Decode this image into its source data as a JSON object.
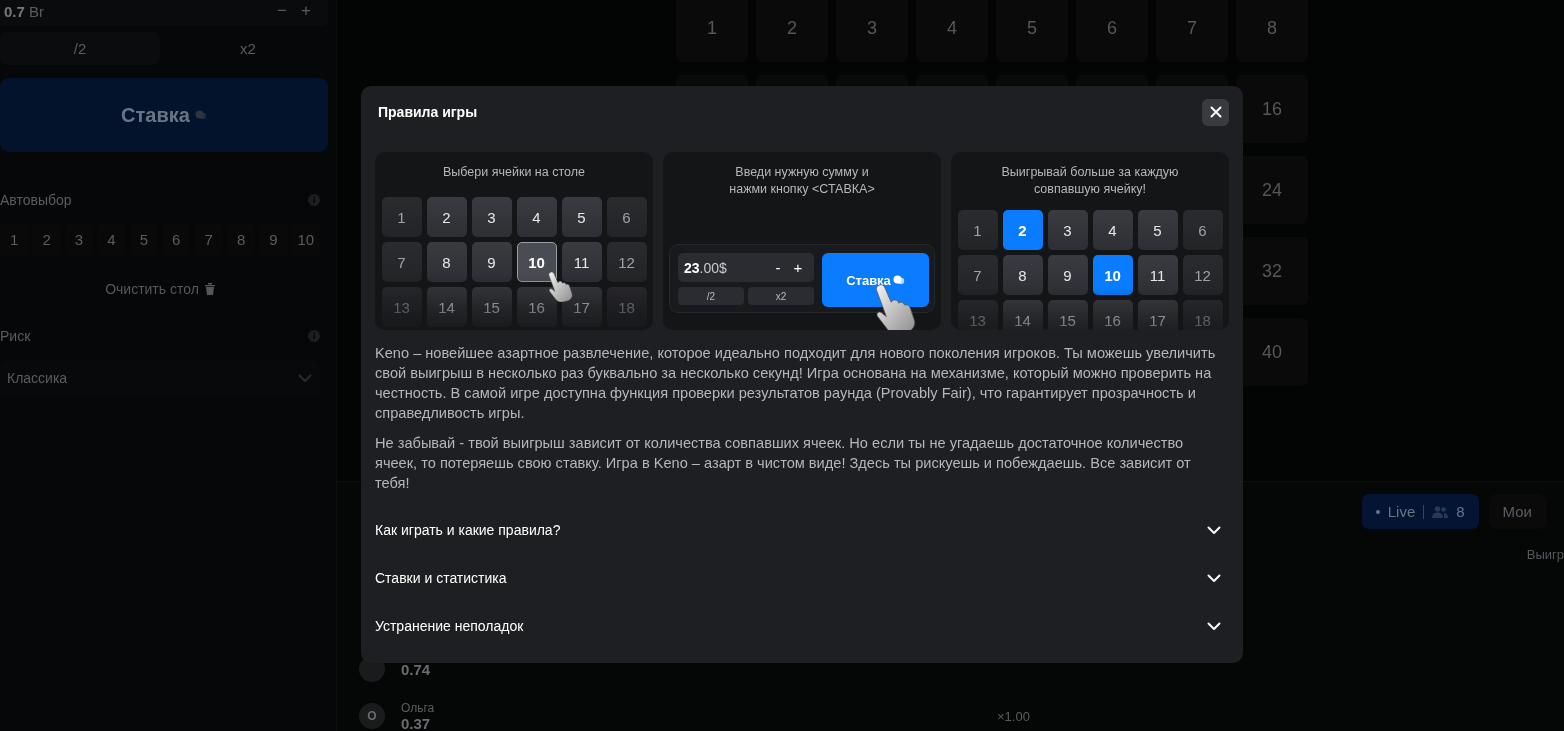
{
  "sidebar": {
    "amount": "**0.7** Br",
    "minus": "−",
    "plus": "+",
    "halve": "/2",
    "double": "x2",
    "bet_button": "Ставка",
    "autoselect": {
      "label": "Автовыбор",
      "numbers": [
        "1",
        "2",
        "3",
        "4",
        "5",
        "6",
        "7",
        "8",
        "9",
        "10"
      ]
    },
    "clear_button": "Очистить стол",
    "risk": {
      "label": "Риск",
      "value": "Классика"
    }
  },
  "board": {
    "row_1": [
      "1",
      "2",
      "3",
      "4",
      "5",
      "6",
      "7",
      "8"
    ],
    "column_8": [
      "16",
      "24",
      "32",
      "40"
    ]
  },
  "bets": {
    "tabs": [
      {
        "label": "Live",
        "count": "8",
        "selected": true
      },
      {
        "label": "Мои",
        "selected": false
      }
    ],
    "column_header": "Выигр",
    "rows": [
      {
        "amount": "0.74"
      },
      {
        "avatar": "О",
        "name": "Ольга",
        "amount": "0.37",
        "multiplier": "×1.00"
      }
    ]
  },
  "dialog": {
    "title": "Правила игры",
    "steps": [
      {
        "kind": "pick",
        "caption": "Выбери ячейки на столе",
        "cells": [
          {
            "label": "1",
            "selected": false
          },
          {
            "label": "2",
            "selected": false
          },
          {
            "label": "3",
            "selected": false
          },
          {
            "label": "4",
            "selected": false
          },
          {
            "label": "5",
            "selected": false
          },
          {
            "label": "6",
            "selected": false
          },
          {
            "label": "7",
            "selected": false
          },
          {
            "label": "8",
            "selected": false
          },
          {
            "label": "9",
            "selected": false
          },
          {
            "label": "10",
            "selected": true
          },
          {
            "label": "11",
            "selected": false
          },
          {
            "label": "12",
            "selected": false
          },
          {
            "label": "13",
            "selected": false
          },
          {
            "label": "14",
            "selected": false
          },
          {
            "label": "15",
            "selected": false
          },
          {
            "label": "16",
            "selected": false
          },
          {
            "label": "17",
            "selected": false
          },
          {
            "label": "18",
            "selected": false
          }
        ]
      },
      {
        "kind": "bet",
        "caption": "Введи нужную сумму и\nнажми кнопку <СТАВКА>",
        "amount": "**23**.00$",
        "minus": "-",
        "plus": "+",
        "halve": "/2",
        "double": "x2",
        "button": "Ставка"
      },
      {
        "kind": "win",
        "caption": "Выигрывай больше за каждую\nсовпавшую ячейку!",
        "cells": [
          {
            "label": "1",
            "selected": false
          },
          {
            "label": "2",
            "selected": true
          },
          {
            "label": "3",
            "selected": false
          },
          {
            "label": "4",
            "selected": false
          },
          {
            "label": "5",
            "selected": false
          },
          {
            "label": "6",
            "selected": false
          },
          {
            "label": "7",
            "selected": false
          },
          {
            "label": "8",
            "selected": false
          },
          {
            "label": "9",
            "selected": false
          },
          {
            "label": "10",
            "selected": true
          },
          {
            "label": "11",
            "selected": false
          },
          {
            "label": "12",
            "selected": false
          },
          {
            "label": "13",
            "selected": false
          },
          {
            "label": "14",
            "selected": false
          },
          {
            "label": "15",
            "selected": false
          },
          {
            "label": "16",
            "selected": false
          },
          {
            "label": "17",
            "selected": false
          },
          {
            "label": "18",
            "selected": false
          }
        ]
      }
    ],
    "paragraphs": [
      "Keno – новейшее азартное развлечение, которое идеально подходит для нового поколения игроков. Ты можешь увеличить свой выигрыш в несколько раз буквально за несколько секунд! Игра основана на механизме, который можно проверить на честность. В самой игре доступна функция проверки результатов раунда (Provably Fair), что гарантирует прозрачность и справедливость игры.",
      "Не забывай - твой выигрыш зависит от количества совпавших ячеек. Но если ты не угадаешь достаточное количество ячеек, то потеряешь свою ставку. Игра в Keno – азарт в чистом виде! Здесь ты рискуешь и побеждаешь. Все зависит от тебя!"
    ],
    "sections": [
      {
        "title": "Как играть и какие правила?",
        "expanded": false
      },
      {
        "title": "Ставки и статистика",
        "expanded": false
      },
      {
        "title": "Устранение неполадок",
        "expanded": false
      }
    ]
  }
}
